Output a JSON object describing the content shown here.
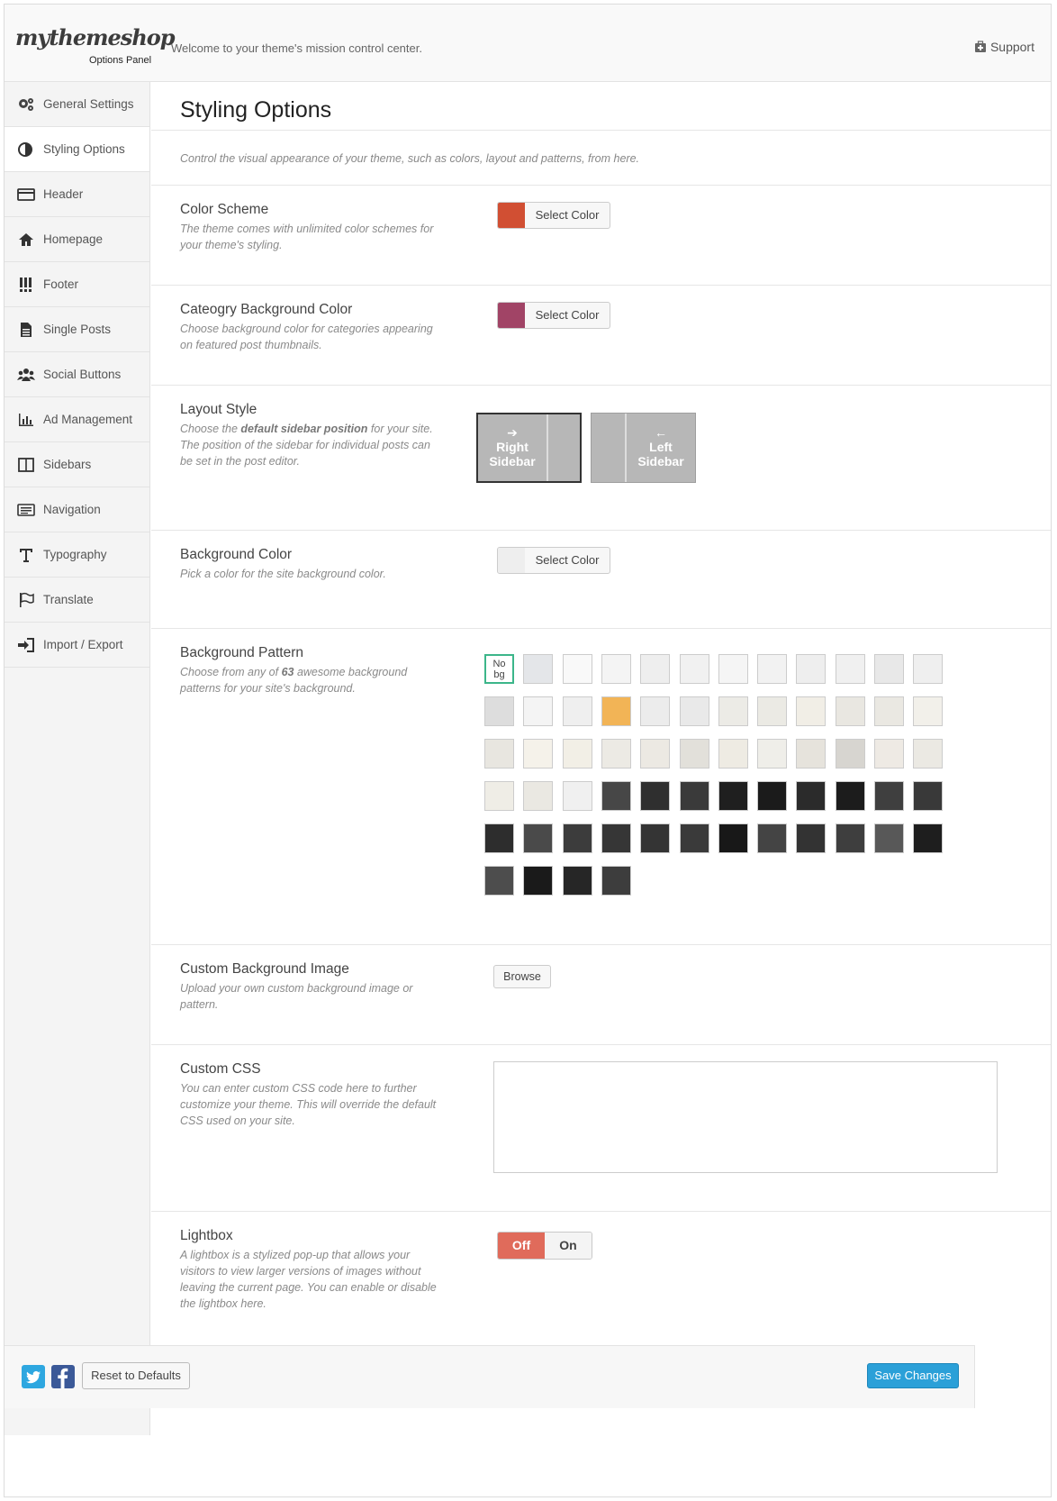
{
  "header": {
    "logo": "mythemeshop",
    "logo_sub": "Options Panel",
    "welcome": "Welcome to your theme's mission control center.",
    "support": "Support"
  },
  "sidebar": {
    "items": [
      {
        "label": "General Settings",
        "icon": "gears-icon"
      },
      {
        "label": "Styling Options",
        "icon": "contrast-icon"
      },
      {
        "label": "Header",
        "icon": "header-icon"
      },
      {
        "label": "Homepage",
        "icon": "home-icon"
      },
      {
        "label": "Footer",
        "icon": "footer-icon"
      },
      {
        "label": "Single Posts",
        "icon": "document-icon"
      },
      {
        "label": "Social Buttons",
        "icon": "users-icon"
      },
      {
        "label": "Ad Management",
        "icon": "bar-chart-icon"
      },
      {
        "label": "Sidebars",
        "icon": "columns-icon"
      },
      {
        "label": "Navigation",
        "icon": "list-icon"
      },
      {
        "label": "Typography",
        "icon": "text-icon"
      },
      {
        "label": "Translate",
        "icon": "flag-icon"
      },
      {
        "label": "Import / Export",
        "icon": "sign-in-icon"
      }
    ]
  },
  "main": {
    "title": "Styling Options",
    "description": "Control the visual appearance of your theme, such as colors, layout and patterns, from here.",
    "color_scheme": {
      "label": "Color Scheme",
      "desc": "The theme comes with unlimited color schemes for your theme's styling.",
      "button": "Select Color",
      "color": "#d14f33"
    },
    "category_bg": {
      "label": "Cateogry Background Color",
      "desc": "Choose background color for categories appearing on featured post thumbnails.",
      "button": "Select Color",
      "color": "#a14466"
    },
    "layout": {
      "label": "Layout Style",
      "desc_1": "Choose the ",
      "desc_bold": "default sidebar position",
      "desc_2": " for your site. The position of the sidebar for individual posts can be set in the post editor.",
      "options": [
        {
          "arrow": "➔",
          "line1": "Right",
          "line2": "Sidebar",
          "selected": true
        },
        {
          "arrow": "←",
          "line1": "Left",
          "line2": "Sidebar",
          "selected": false
        }
      ]
    },
    "background_color": {
      "label": "Background Color",
      "desc": "Pick a color for the site background color.",
      "button": "Select Color",
      "color": "#eeeeee"
    },
    "pattern": {
      "label": "Background Pattern",
      "desc_1": "Choose from any of ",
      "desc_bold": "63",
      "desc_2": " awesome background patterns for your site's background.",
      "nobg_label_1": "No",
      "nobg_label_2": "bg",
      "patterns": [
        "#e4e6e9",
        "#f9f9f9",
        "#f4f4f4",
        "#eeeeee",
        "#f1f1f1",
        "#f5f5f5",
        "#f2f2f2",
        "#eeeeee",
        "#f0f0f0",
        "#e8e8e8",
        "#efefef",
        "#dddddd",
        "#f4f4f4",
        "#efefef",
        "#f2b456",
        "#ececec",
        "#e9e9e9",
        "#ecebe6",
        "#ebeae4",
        "#f1eee6",
        "#e9e7e1",
        "#eae8e2",
        "#f2f0ea",
        "#e8e6e0",
        "#f5f2ea",
        "#f2efe6",
        "#eceae4",
        "#ece9e3",
        "#e2e0da",
        "#eeebe3",
        "#efeee9",
        "#e6e3dc",
        "#d7d5d0",
        "#eeeae4",
        "#ebe9e3",
        "#efede6",
        "#eae8e2",
        "#f0f0f0",
        "#474747",
        "#2f2f2f",
        "#3a3a3a",
        "#1f1f1f",
        "#1b1b1b",
        "#2b2b2b",
        "#1c1c1c",
        "#3f3f3f",
        "#393939",
        "#2d2d2d",
        "#4a4a4a",
        "#3c3c3c",
        "#363636",
        "#343434",
        "#3a3a3a",
        "#181818",
        "#444444",
        "#333333",
        "#3e3e3e",
        "#585858",
        "#1e1e1e",
        "#4d4d4d",
        "#1a1a1a",
        "#262626",
        "#3d3d3d"
      ]
    },
    "custom_bg": {
      "label": "Custom Background Image",
      "desc": "Upload your own custom background image or pattern.",
      "button": "Browse"
    },
    "custom_css": {
      "label": "Custom CSS",
      "desc": "You can enter custom CSS code here to further customize your theme. This will override the default CSS used on your site.",
      "value": ""
    },
    "lightbox": {
      "label": "Lightbox",
      "desc": "A lightbox is a stylized pop-up that allows your visitors to view larger versions of images without leaving the current page. You can enable or disable the lightbox here.",
      "off": "Off",
      "on": "On"
    }
  },
  "footer": {
    "reset": "Reset to Defaults",
    "save": "Save Changes",
    "twitter_color": "#2ea7e0",
    "facebook_color": "#3b5998"
  }
}
